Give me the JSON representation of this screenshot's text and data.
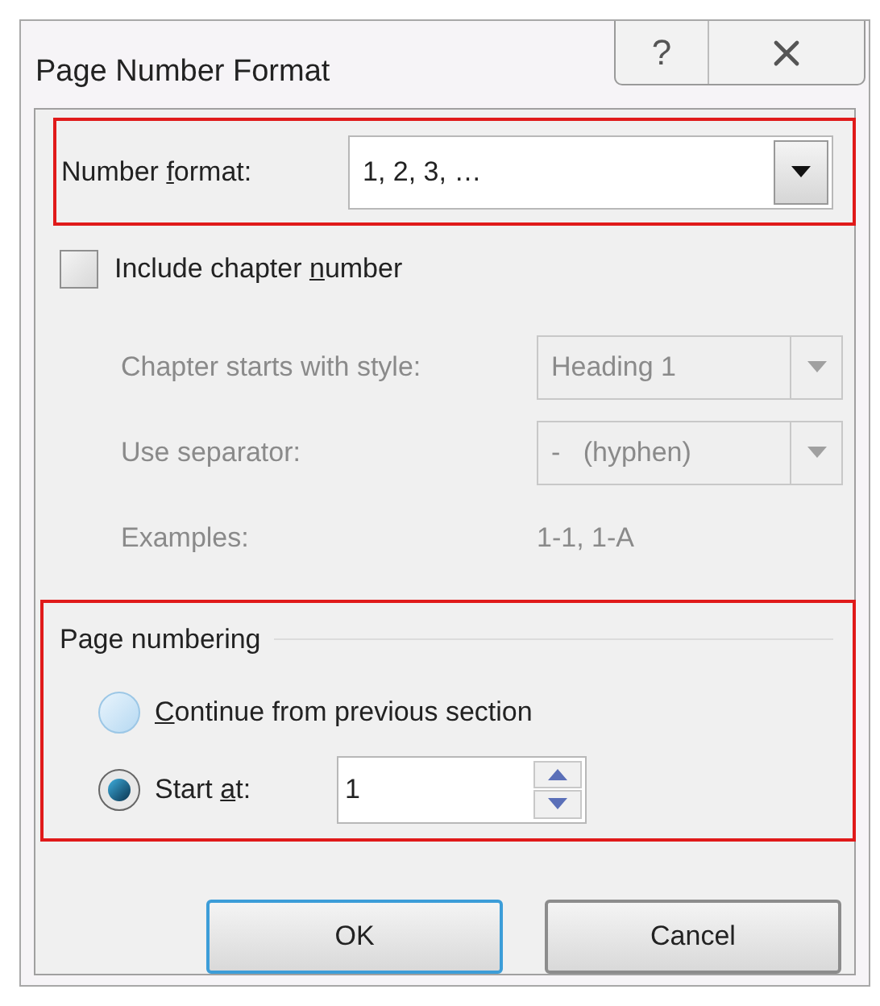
{
  "window": {
    "title": "Page Number Format",
    "help": "?"
  },
  "number_format": {
    "label": {
      "before": "Number ",
      "key": "f",
      "after": "ormat:"
    },
    "value": "1, 2, 3, …",
    "highlighted": true
  },
  "include_chapter_number": {
    "label": {
      "before": "Include chapter ",
      "key": "n",
      "after": "umber"
    },
    "checked": false
  },
  "chapter_fields": [
    {
      "kind": "dropdown",
      "label": "Chapter starts with style:",
      "value": "Heading 1",
      "disabled": true
    },
    {
      "kind": "dropdown",
      "label": "Use separator:",
      "value": "-   (hyphen)",
      "disabled": true
    },
    {
      "kind": "text",
      "label": "Examples:",
      "value": "1-1, 1-A",
      "disabled": true
    }
  ],
  "page_numbering": {
    "title": "Page numbering",
    "highlighted": true,
    "options": [
      {
        "kind": "radio",
        "label": {
          "key": "C",
          "after": "ontinue from previous section"
        },
        "selected": false
      },
      {
        "kind": "spin",
        "label": {
          "before": "Start ",
          "key": "a",
          "after": "t:"
        },
        "selected": true,
        "value": "1"
      }
    ]
  },
  "buttons": [
    {
      "label": "OK",
      "default": true
    },
    {
      "label": "Cancel",
      "default": false
    }
  ]
}
